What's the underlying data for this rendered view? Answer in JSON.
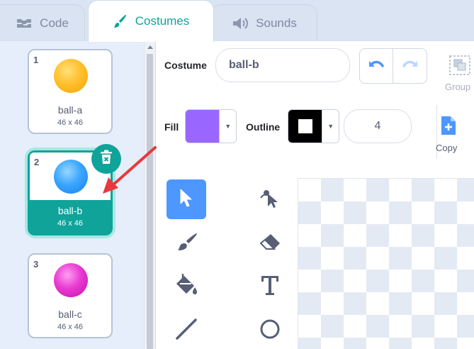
{
  "tabs": [
    {
      "label": "Code",
      "icon": "code-blocks-icon"
    },
    {
      "label": "Costumes",
      "icon": "paintbrush-icon",
      "active": true
    },
    {
      "label": "Sounds",
      "icon": "speaker-icon"
    }
  ],
  "costumes": [
    {
      "number": "1",
      "name": "ball-a",
      "size": "46 x 46",
      "color": "#ffb21e"
    },
    {
      "number": "2",
      "name": "ball-b",
      "size": "46 x 46",
      "color": "#2f9bff",
      "selected": true
    },
    {
      "number": "3",
      "name": "ball-c",
      "size": "46 x 46",
      "color": "#e02fc6"
    }
  ],
  "editor": {
    "costume_label": "Costume",
    "costume_name": "ball-b",
    "fill_label": "Fill",
    "fill_color": "#9966ff",
    "outline_label": "Outline",
    "outline_color": "#000000",
    "outline_width": "4",
    "group_label": "Group",
    "copy_label": "Copy"
  },
  "tools": [
    "select-tool",
    "reshape-tool",
    "brush-tool",
    "eraser-tool",
    "fill-tool",
    "text-tool",
    "line-tool",
    "circle-tool"
  ],
  "colors": {
    "accent": "#0fa39a",
    "tool_active": "#4d97ff",
    "annotation_arrow": "#e8383d"
  }
}
